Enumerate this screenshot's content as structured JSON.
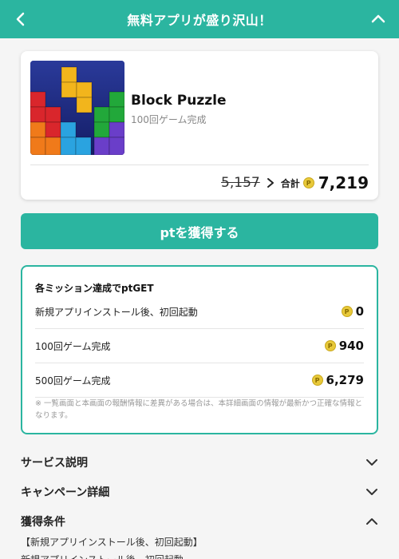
{
  "header": {
    "title": "無料アプリが盛り沢山！",
    "back_icon": "chevron-left-icon",
    "collapse_icon": "chevron-up-icon"
  },
  "app": {
    "name": "Block Puzzle",
    "subtitle": "100回ゲーム完成",
    "old_points": "5,157",
    "total_label": "合計",
    "total_points": "7,219",
    "coin_glyph": "P"
  },
  "cta": {
    "label": "ptを獲得する"
  },
  "missions": {
    "title": "各ミッション達成でptGET",
    "rows": [
      {
        "label": "新規アプリインストール後、初回起動",
        "points": "0"
      },
      {
        "label": "100回ゲーム完成",
        "points": "940"
      },
      {
        "label": "500回ゲーム完成",
        "points": "6,279"
      }
    ],
    "note": "※ 一覧画面と本画面の報酬情報に差異がある場合は、本詳細画面の情報が最新かつ正確な情報となります。"
  },
  "accordions": [
    {
      "label": "サービス説明",
      "expanded": false
    },
    {
      "label": "キャンペーン詳細",
      "expanded": false
    },
    {
      "label": "獲得条件",
      "expanded": true
    }
  ],
  "conditions": {
    "line1": "【新規アプリインストール後、初回起動】",
    "line2": "新規アプリインストール後、初回起動"
  },
  "colors": {
    "accent": "#2bb5a0",
    "coin": "#e8c93a"
  }
}
